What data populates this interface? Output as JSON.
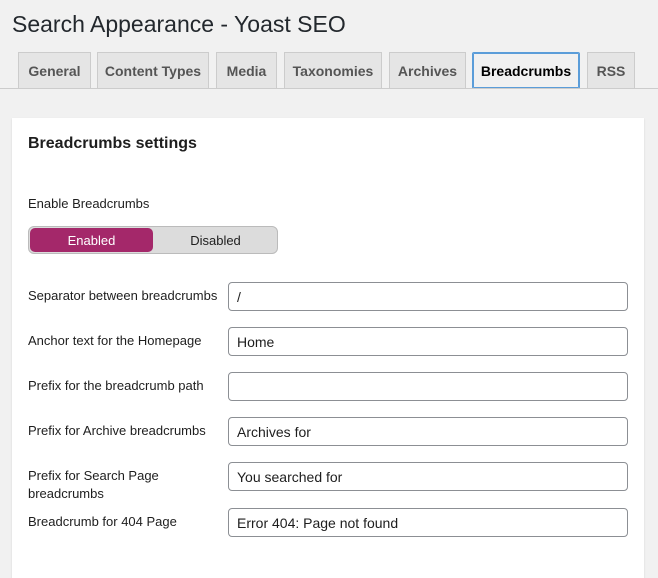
{
  "page": {
    "title": "Search Appearance - Yoast SEO"
  },
  "tabs": [
    {
      "label": "General"
    },
    {
      "label": "Content Types"
    },
    {
      "label": "Media"
    },
    {
      "label": "Taxonomies"
    },
    {
      "label": "Archives"
    },
    {
      "label": "Breadcrumbs",
      "active": true
    },
    {
      "label": "RSS"
    }
  ],
  "panel": {
    "title": "Breadcrumbs settings",
    "enable_label": "Enable Breadcrumbs",
    "toggle": {
      "on_label": "Enabled",
      "off_label": "Disabled",
      "selected": "Enabled",
      "accent": "#a4286a"
    },
    "fields": [
      {
        "label": "Separator between breadcrumbs",
        "value": "/"
      },
      {
        "label": "Anchor text for the Homepage",
        "value": "Home"
      },
      {
        "label": "Prefix for the breadcrumb path",
        "value": ""
      },
      {
        "label": "Prefix for Archive breadcrumbs",
        "value": "Archives for"
      },
      {
        "label": "Prefix for Search Page breadcrumbs",
        "value": "You searched for"
      },
      {
        "label": "Breadcrumb for 404 Page",
        "value": "Error 404: Page not found"
      }
    ]
  }
}
